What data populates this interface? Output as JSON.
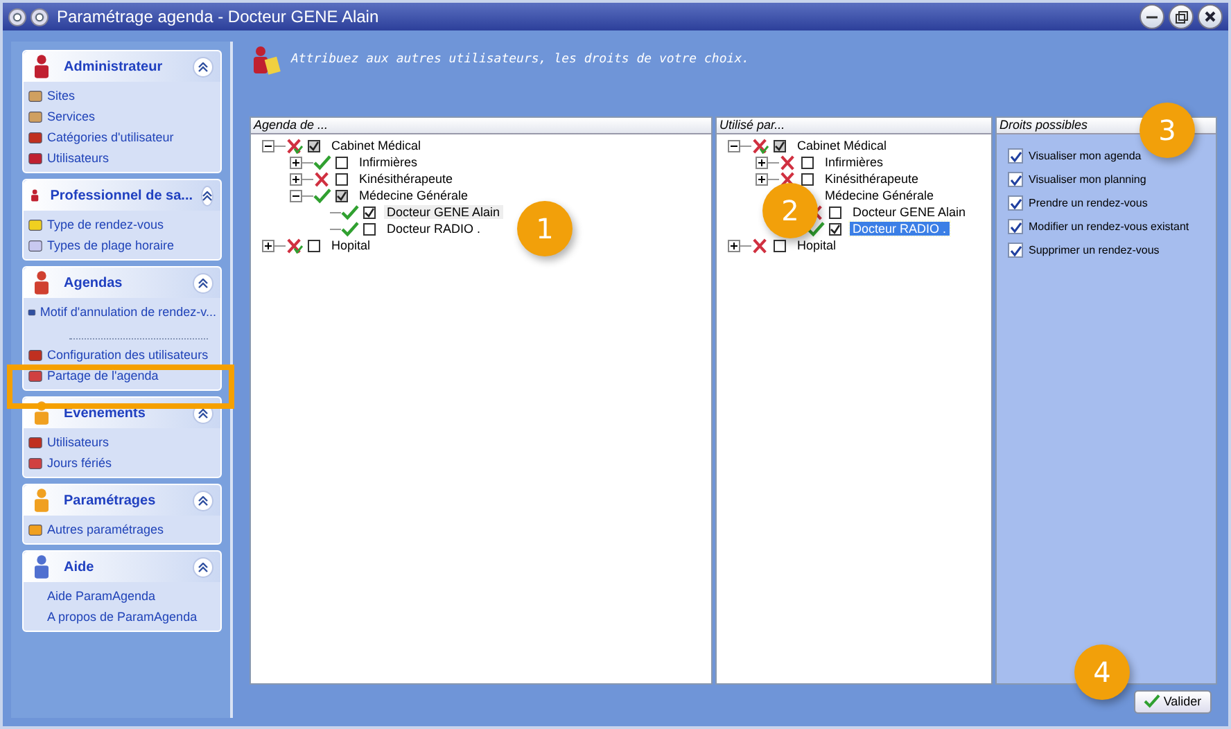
{
  "window": {
    "title": "Paramétrage agenda - Docteur GENE Alain"
  },
  "sidebar": {
    "groups": [
      {
        "title": "Administrateur",
        "items": [
          {
            "kind": "link",
            "label": "Sites"
          },
          {
            "kind": "link",
            "label": "Services"
          },
          {
            "kind": "link",
            "label": "Catégories d'utilisateur"
          },
          {
            "kind": "link",
            "label": "Utilisateurs"
          }
        ]
      },
      {
        "title": "Professionnel de sa...",
        "items": [
          {
            "kind": "link",
            "label": "Type de rendez-vous"
          },
          {
            "kind": "link",
            "label": "Types de plage horaire"
          }
        ]
      },
      {
        "title": "Agendas",
        "items": [
          {
            "kind": "link",
            "label": "Motif d'annulation de rendez-v..."
          },
          {
            "kind": "divider"
          },
          {
            "kind": "link",
            "label": "Configuration des utilisateurs"
          },
          {
            "kind": "link",
            "label": "Partage de l'agenda"
          }
        ]
      },
      {
        "title": "Evénements",
        "items": [
          {
            "kind": "link",
            "label": "Utilisateurs"
          },
          {
            "kind": "link",
            "label": "Jours fériés"
          }
        ]
      },
      {
        "title": "Paramétrages",
        "items": [
          {
            "kind": "link",
            "label": "Autres paramétrages"
          }
        ]
      },
      {
        "title": "Aide",
        "items": [
          {
            "kind": "link",
            "label": "Aide ParamAgenda"
          },
          {
            "kind": "link",
            "label": "A propos de ParamAgenda"
          }
        ]
      }
    ]
  },
  "header": {
    "text": "Attribuez aux autres utilisateurs, les droits de votre choix."
  },
  "agenda_tree": {
    "title": "Agenda de ...",
    "nodes": [
      {
        "label": "Cabinet Médical",
        "allowed": false,
        "partial": true,
        "checked": true,
        "expanded": true,
        "selected": false,
        "children": [
          {
            "label": "Infirmières",
            "allowed": true,
            "checked": false,
            "expanded": false,
            "selected": false
          },
          {
            "label": "Kinésithérapeute",
            "allowed": false,
            "partial": false,
            "checked": false,
            "expanded": false,
            "selected": false
          },
          {
            "label": "Médecine Générale",
            "allowed": true,
            "checked": true,
            "expanded": true,
            "selected": false,
            "children": [
              {
                "label": "Docteur GENE Alain",
                "allowed": true,
                "checked": true,
                "selected": true
              },
              {
                "label": "Docteur RADIO .",
                "allowed": true,
                "checked": false,
                "selected": false
              }
            ]
          }
        ]
      },
      {
        "label": "Hopital",
        "allowed": false,
        "partial": true,
        "checked": false,
        "expanded": false,
        "selected": false
      }
    ]
  },
  "used_by_tree": {
    "title": "Utilisé par...",
    "nodes": [
      {
        "label": "Cabinet Médical",
        "allowed": false,
        "partial": true,
        "checked": true,
        "expanded": true,
        "selected": false,
        "children": [
          {
            "label": "Infirmières",
            "allowed": false,
            "partial": false,
            "checked": false,
            "expanded": false,
            "selected": false
          },
          {
            "label": "Kinésithérapeute",
            "allowed": false,
            "partial": false,
            "checked": false,
            "expanded": false,
            "selected": false
          },
          {
            "label": "Médecine Générale",
            "selected": false,
            "children": [
              {
                "label": "Docteur GENE Alain",
                "allowed": false,
                "partial": false,
                "checked": false,
                "selected": false
              },
              {
                "label": "Docteur RADIO .",
                "allowed": true,
                "checked": true,
                "selected": true
              }
            ]
          }
        ]
      },
      {
        "label": "Hopital",
        "allowed": false,
        "partial": false,
        "checked": false,
        "expanded": false,
        "selected": false
      }
    ]
  },
  "rights": {
    "title": "Droits possibles",
    "items": [
      {
        "label": "Visualiser mon agenda",
        "checked": true
      },
      {
        "label": "Visualiser mon planning",
        "checked": true
      },
      {
        "label": "Prendre un rendez-vous",
        "checked": true
      },
      {
        "label": "Modifier un rendez-vous existant",
        "checked": true
      },
      {
        "label": "Supprimer un rendez-vous",
        "checked": true
      }
    ]
  },
  "buttons": [
    {
      "label": "Valider"
    }
  ],
  "callouts": [
    "1",
    "2",
    "3",
    "4"
  ]
}
